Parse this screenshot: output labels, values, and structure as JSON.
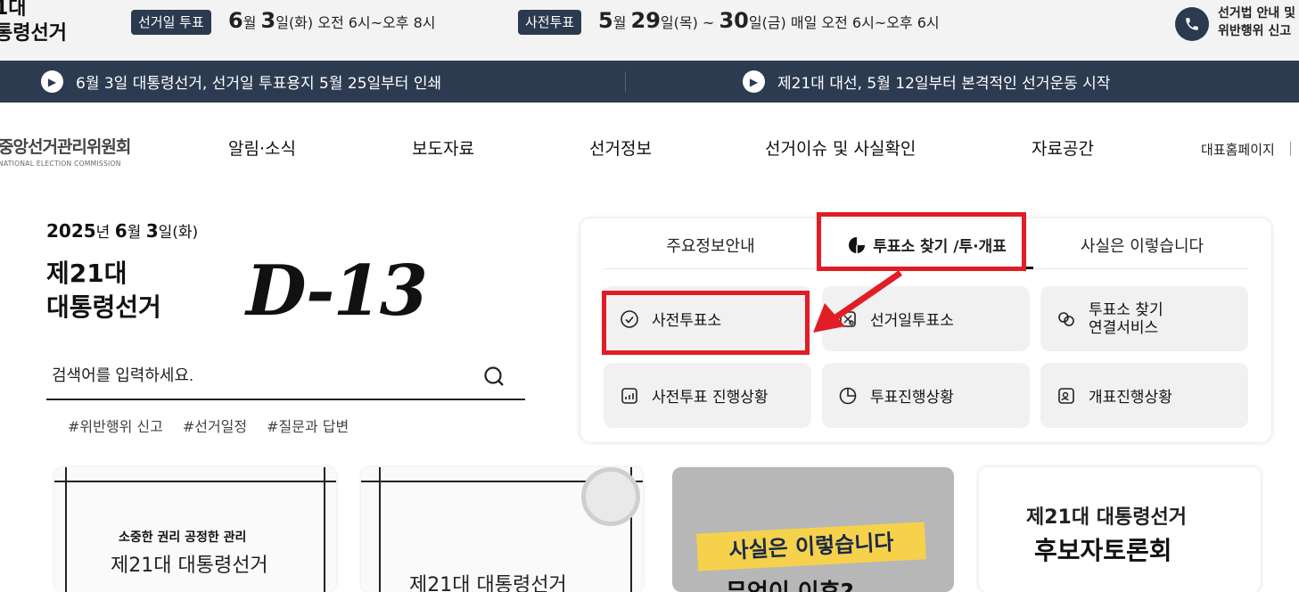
{
  "topbar": {
    "title_line1": "1대",
    "title_line2": "통령선거",
    "election_day_badge": "선거일 투표",
    "election_day_schedule": {
      "month": "6",
      "m_unit": "월 ",
      "day": "3",
      "rest": "일(화) 오전 6시~오후 8시"
    },
    "early_vote_badge": "사전투표",
    "early_vote_schedule": {
      "month": "5",
      "m_unit": "월 ",
      "day1": "29",
      "mid": "일(목) ~ ",
      "day2": "30",
      "rest": "일(금) 매일 오전 6시~오후 6시"
    },
    "right_line1": "선거법 안내 및",
    "right_line2": "위반행위 신고"
  },
  "newsbar": {
    "items": [
      {
        "text": "6월 3일 대통령선거, 선거일 투표용지 5월 25일부터 인쇄"
      },
      {
        "text": "제21대 대선, 5월 12일부터 본격적인 선거운동 시작"
      }
    ]
  },
  "nav": {
    "logo_ko": "중앙선거관리위원회",
    "logo_en": "NATIONAL ELECTION COMMISSION",
    "items": [
      "알림·소식",
      "보도자료",
      "선거정보",
      "선거이슈 및 사실확인",
      "자료공간"
    ],
    "home_link": "대표홈페이지"
  },
  "hero": {
    "year": "2025",
    "year_unit": "년 ",
    "month": "6",
    "month_unit": "월 ",
    "day": "3",
    "day_unit": "일(화)",
    "election_line1": "제21대",
    "election_line2": "대통령선거",
    "dday": "D-13",
    "search_placeholder": "검색어를 입력하세요.",
    "tags": [
      "#위반행위 신고",
      "#선거일정",
      "#질문과 답변"
    ]
  },
  "panel": {
    "tabs": [
      {
        "label": "주요정보안내",
        "active": false
      },
      {
        "label": "투표소 찾기 /투·개표",
        "active": true
      },
      {
        "label": "사실은 이렇습니다",
        "active": false
      }
    ],
    "tiles": [
      {
        "label": "사전투표소",
        "icon": "check-circle-icon"
      },
      {
        "label": "선거일투표소",
        "icon": "ballot-box-icon"
      },
      {
        "label_line1": "투표소 찾기",
        "label_line2": "연결서비스",
        "icon": "link-circles-icon"
      },
      {
        "label": "사전투표 진행상황",
        "icon": "bar-chart-icon"
      },
      {
        "label": "투표진행상황",
        "icon": "pie-chart-icon"
      },
      {
        "label": "개표진행상황",
        "icon": "person-badge-icon"
      }
    ]
  },
  "cards": {
    "card1_small": "소중한 권리 공정한 관리",
    "card1_main": "제21대 대통령선거",
    "card2_main": "제21대 대통령선거",
    "card3_tag": "사실은 이렇습니다",
    "card3_bottom": "무엇이 이후?",
    "card4_line1": "제21대 대통령선거",
    "card4_line2": "후보자토론회"
  },
  "colors": {
    "navy": "#2d3b51",
    "highlight_red": "#e11d26",
    "tile_bg": "#f1f1f1",
    "tag_yellow": "#f6d14b"
  }
}
